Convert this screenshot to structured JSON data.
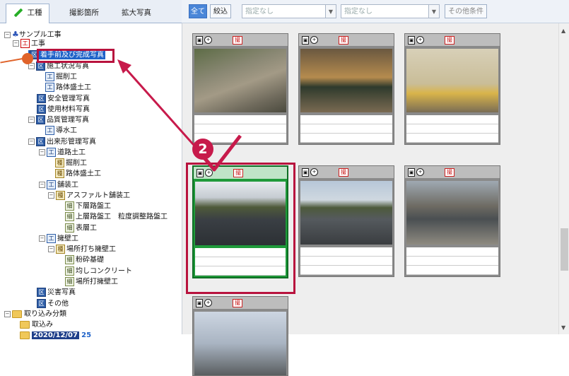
{
  "tabs": {
    "construction": "工種",
    "location": "撮影箇所",
    "enlarged": "拡大写真"
  },
  "toolbar": {
    "all": "全て",
    "filter": "絞込",
    "sel1_placeholder": "指定なし",
    "sel2_placeholder": "指定なし",
    "other_conditions": "その他条件"
  },
  "tree": [
    {
      "id": "n0",
      "label": "サンプル工事",
      "icon": "sample"
    },
    {
      "id": "n1",
      "label": "工事",
      "icon": "red"
    },
    {
      "id": "n2",
      "label": "着手前及び完成写真",
      "badge": "区"
    },
    {
      "id": "n3",
      "label": "施工状況写真",
      "badge": "区"
    },
    {
      "id": "n4",
      "label": "掘削工",
      "badge": "工"
    },
    {
      "id": "n5",
      "label": "路体盛土工",
      "badge": "工"
    },
    {
      "id": "n6",
      "label": "安全管理写真",
      "badge": "区"
    },
    {
      "id": "n7",
      "label": "使用材料写真",
      "badge": "区"
    },
    {
      "id": "n8",
      "label": "品質管理写真",
      "badge": "区"
    },
    {
      "id": "n9",
      "label": "導水工",
      "badge": "工"
    },
    {
      "id": "n10",
      "label": "出来形管理写真",
      "badge": "区"
    },
    {
      "id": "n11",
      "label": "道路土工",
      "badge": "工"
    },
    {
      "id": "n12",
      "label": "掘削工",
      "badge": "種"
    },
    {
      "id": "n13",
      "label": "路体盛土工",
      "badge": "種"
    },
    {
      "id": "n14",
      "label": "舗装工",
      "badge": "工"
    },
    {
      "id": "n15",
      "label": "アスファルト舗装工",
      "badge": "種"
    },
    {
      "id": "n16",
      "label": "下層路盤工",
      "badge": "細"
    },
    {
      "id": "n17",
      "label": "上層路盤工　粒度調整路盤工",
      "badge": "細"
    },
    {
      "id": "n18",
      "label": "表層工",
      "badge": "細"
    },
    {
      "id": "n19",
      "label": "擁壁工",
      "badge": "工"
    },
    {
      "id": "n20",
      "label": "場所打ち擁壁工",
      "badge": "種"
    },
    {
      "id": "n21",
      "label": "粉砕基礎",
      "badge": "細"
    },
    {
      "id": "n22",
      "label": "均しコンクリート",
      "badge": "細"
    },
    {
      "id": "n23",
      "label": "場所打擁壁工",
      "badge": "細"
    },
    {
      "id": "n24",
      "label": "災害写真",
      "badge": "区"
    },
    {
      "id": "n25",
      "label": "その他",
      "badge": "区"
    },
    {
      "id": "n26",
      "label": "取り込み分類",
      "icon": "folder"
    },
    {
      "id": "n27",
      "label": "取込み",
      "icon": "folder"
    },
    {
      "id": "n28",
      "label": "2020/12/07",
      "count": "25",
      "icon": "folder"
    }
  ],
  "card_icons": {
    "camera": "▣",
    "plus": "+",
    "ban": "撮"
  },
  "step_number": "2",
  "colors": {
    "accent": "#c71a4b",
    "selected": "#1f9a3a",
    "tab_blue": "#4a86d8"
  }
}
